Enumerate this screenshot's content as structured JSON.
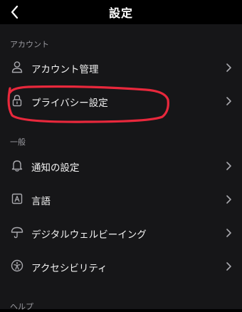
{
  "header": {
    "title": "設定",
    "back_icon": "chevron-left-icon"
  },
  "sections": {
    "account": {
      "label": "アカウント",
      "items": [
        {
          "label": "アカウント管理",
          "icon": "person-icon"
        },
        {
          "label": "プライバシー設定",
          "icon": "lock-icon"
        }
      ]
    },
    "general": {
      "label": "一般",
      "items": [
        {
          "label": "通知の設定",
          "icon": "bell-icon"
        },
        {
          "label": "言語",
          "icon": "language-icon"
        },
        {
          "label": "デジタルウェルビーイング",
          "icon": "umbrella-icon"
        },
        {
          "label": "アクセシビリティ",
          "icon": "accessibility-icon"
        }
      ]
    },
    "help": {
      "label": "ヘルプ"
    }
  },
  "colors": {
    "background": "#161618",
    "header_background": "#000000",
    "text": "#f2f2f2",
    "section_label": "#9a9aa0",
    "icon": "#a8a8ad",
    "annotation": "#e8283c"
  }
}
